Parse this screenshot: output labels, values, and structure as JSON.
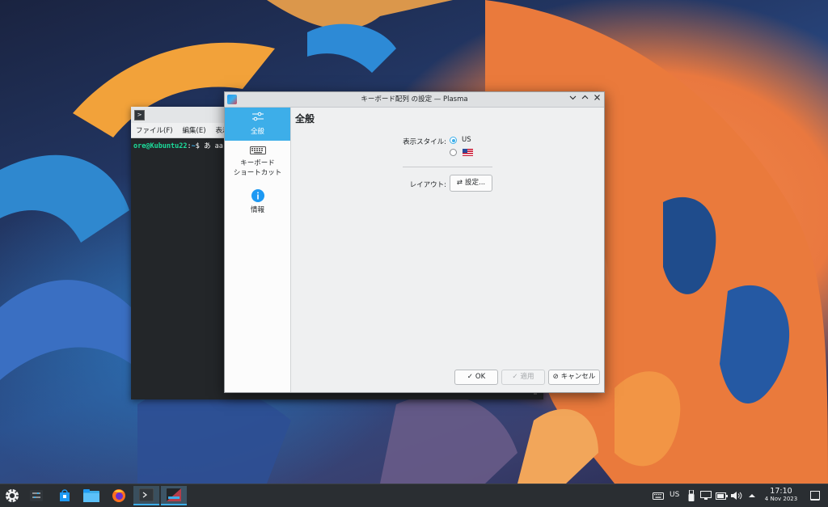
{
  "terminal": {
    "menu": [
      "ファイル(F)",
      "編集(E)",
      "表示"
    ],
    "prompt_user": "ore@Kubuntu22",
    "prompt_sep": ":",
    "prompt_path": "~",
    "prompt_symbol": "$",
    "prompt_input": "あ aa"
  },
  "dialog": {
    "title": "キーボード配列 の設定 — Plasma",
    "sidebar": [
      {
        "label": "全般",
        "icon": "sliders-icon",
        "active": true
      },
      {
        "label_line1": "キーボード",
        "label_line2": "ショートカット",
        "icon": "keyboard-icon",
        "active": false
      },
      {
        "label": "情報",
        "icon": "info-icon",
        "active": false
      }
    ],
    "page_title": "全般",
    "display_style_label": "表示スタイル:",
    "display_style_options": [
      {
        "label": "US",
        "checked": true
      },
      {
        "label": "",
        "icon": "us-flag-icon",
        "checked": false
      }
    ],
    "layout_label": "レイアウト:",
    "layout_button": "設定...",
    "buttons": {
      "ok": "OK",
      "apply": "適用",
      "cancel": "キャンセル"
    }
  },
  "taskbar": {
    "keyboard_indicator": "US",
    "time": "17:10",
    "date": "4 Nov 2023",
    "accent_color": "#3daee9"
  }
}
